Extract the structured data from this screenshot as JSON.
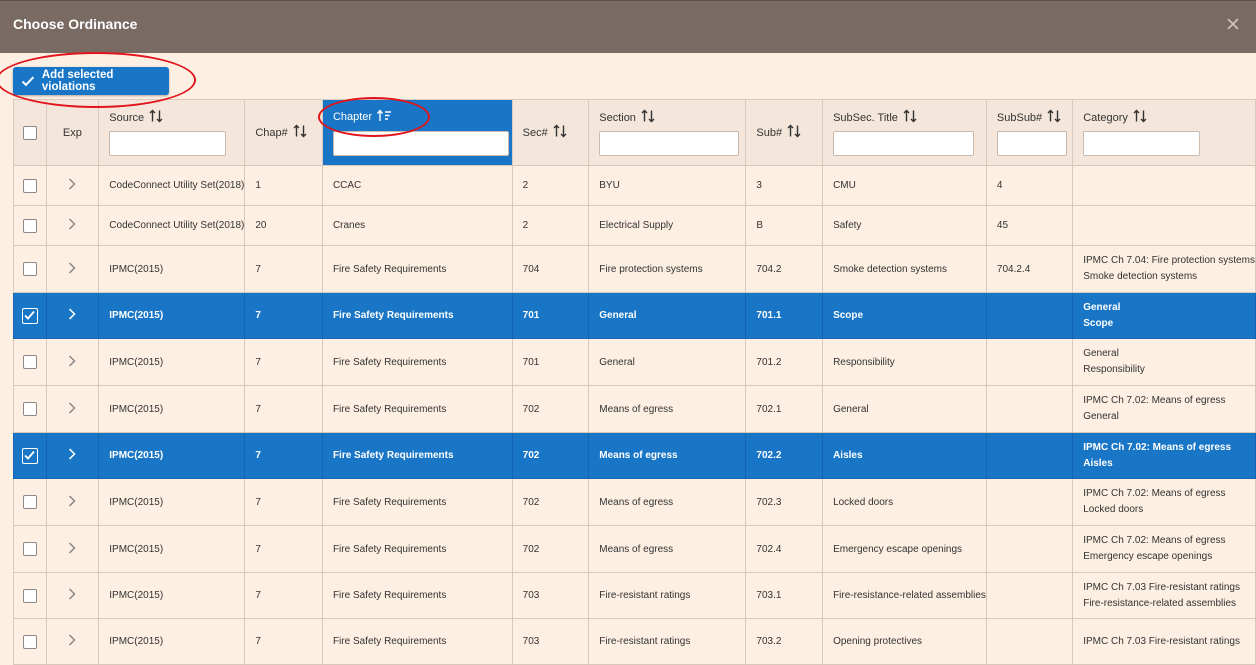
{
  "dialog": {
    "title": "Choose Ordinance",
    "close_glyph": "×"
  },
  "toolbar": {
    "add_label": "Add selected violations"
  },
  "columns": [
    {
      "key": "select",
      "label": ""
    },
    {
      "key": "exp",
      "label": "Exp"
    },
    {
      "key": "source",
      "label": "Source"
    },
    {
      "key": "chap",
      "label": "Chap#"
    },
    {
      "key": "chapter",
      "label": "Chapter"
    },
    {
      "key": "sec",
      "label": "Sec#"
    },
    {
      "key": "section",
      "label": "Section"
    },
    {
      "key": "sub",
      "label": "Sub#"
    },
    {
      "key": "subsec_title",
      "label": "SubSec. Title"
    },
    {
      "key": "subsub",
      "label": "SubSub#"
    },
    {
      "key": "category",
      "label": "Category"
    }
  ],
  "rows": [
    {
      "selected": false,
      "source": "CodeConnect Utility Set(2018)",
      "chap": "1",
      "chapter": "CCAC",
      "sec": "2",
      "section": "BYU",
      "sub": "3",
      "subsec_title": "CMU",
      "subsub": "4",
      "category_1": "",
      "category_2": ""
    },
    {
      "selected": false,
      "source": "CodeConnect Utility Set(2018)",
      "chap": "20",
      "chapter": "Cranes",
      "sec": "2",
      "section": "Electrical Supply",
      "sub": "B",
      "subsec_title": "Safety",
      "subsub": "45",
      "category_1": "",
      "category_2": ""
    },
    {
      "selected": false,
      "source": "IPMC(2015)",
      "chap": "7",
      "chapter": "Fire Safety Requirements",
      "sec": "704",
      "section": "Fire protection systems",
      "sub": "704.2",
      "subsec_title": "Smoke detection systems",
      "subsub": "704.2.4",
      "category_1": "IPMC Ch 7.04: Fire protection systems",
      "category_2": "Smoke detection systems"
    },
    {
      "selected": true,
      "source": "IPMC(2015)",
      "chap": "7",
      "chapter": "Fire Safety Requirements",
      "sec": "701",
      "section": "General",
      "sub": "701.1",
      "subsec_title": "Scope",
      "subsub": "",
      "category_1": "General",
      "category_2": "Scope"
    },
    {
      "selected": false,
      "source": "IPMC(2015)",
      "chap": "7",
      "chapter": "Fire Safety Requirements",
      "sec": "701",
      "section": "General",
      "sub": "701.2",
      "subsec_title": "Responsibility",
      "subsub": "",
      "category_1": "General",
      "category_2": "Responsibility"
    },
    {
      "selected": false,
      "source": "IPMC(2015)",
      "chap": "7",
      "chapter": "Fire Safety Requirements",
      "sec": "702",
      "section": "Means of egress",
      "sub": "702.1",
      "subsec_title": "General",
      "subsub": "",
      "category_1": "IPMC Ch 7.02: Means of egress",
      "category_2": "General"
    },
    {
      "selected": true,
      "source": "IPMC(2015)",
      "chap": "7",
      "chapter": "Fire Safety Requirements",
      "sec": "702",
      "section": "Means of egress",
      "sub": "702.2",
      "subsec_title": "Aisles",
      "subsub": "",
      "category_1": "IPMC Ch 7.02: Means of egress",
      "category_2": "Aisles"
    },
    {
      "selected": false,
      "source": "IPMC(2015)",
      "chap": "7",
      "chapter": "Fire Safety Requirements",
      "sec": "702",
      "section": "Means of egress",
      "sub": "702.3",
      "subsec_title": "Locked doors",
      "subsub": "",
      "category_1": "IPMC Ch 7.02: Means of egress",
      "category_2": "Locked doors"
    },
    {
      "selected": false,
      "source": "IPMC(2015)",
      "chap": "7",
      "chapter": "Fire Safety Requirements",
      "sec": "702",
      "section": "Means of egress",
      "sub": "702.4",
      "subsec_title": "Emergency escape openings",
      "subsub": "",
      "category_1": "IPMC Ch 7.02: Means of egress",
      "category_2": "Emergency escape openings"
    },
    {
      "selected": false,
      "source": "IPMC(2015)",
      "chap": "7",
      "chapter": "Fire Safety Requirements",
      "sec": "703",
      "section": "Fire-resistant ratings",
      "sub": "703.1",
      "subsec_title": "Fire-resistance-related assemblies",
      "subsub": "",
      "category_1": "IPMC Ch 7.03 Fire-resistant ratings",
      "category_2": "Fire-resistance-related assemblies"
    },
    {
      "selected": false,
      "source": "IPMC(2015)",
      "chap": "7",
      "chapter": "Fire Safety Requirements",
      "sec": "703",
      "section": "Fire-resistant ratings",
      "sub": "703.2",
      "subsec_title": "Opening protectives",
      "subsub": "",
      "category_1": "IPMC Ch 7.03 Fire-resistant ratings",
      "category_2": ""
    }
  ],
  "colors": {
    "accent": "#1976c6",
    "titlebar": "#7a6a64",
    "background": "#fdefe2",
    "annotation": "#e0141a"
  },
  "icons": {
    "sort": "sort-arrows-icon",
    "sort_active": "sort-ascending-icon",
    "expand": "chevron-right-icon",
    "check": "checkmark-icon",
    "close": "close-icon"
  }
}
